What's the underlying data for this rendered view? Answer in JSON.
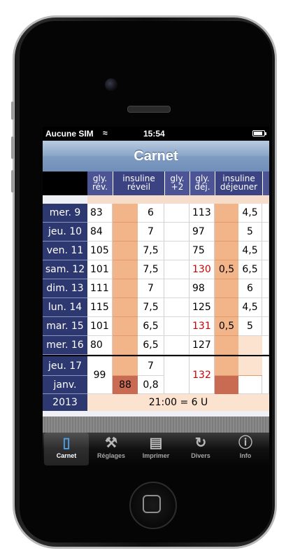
{
  "status": {
    "carrier": "Aucune SIM",
    "time": "15:54"
  },
  "nav": {
    "title": "Carnet"
  },
  "columns": [
    {
      "label": "gly.\nrév."
    },
    {
      "label": "insuline\nréveil"
    },
    {
      "label": "gly.\n+2"
    },
    {
      "label": "gly.\ndéj."
    },
    {
      "label": "insuline\ndéjeuner"
    }
  ],
  "rows": [
    {
      "day": "mer. 9",
      "gly_rev": "83",
      "ins_reveil": "6",
      "gly_plus2": "",
      "gly_dej": "113",
      "ins_dej_a": "",
      "ins_dej_b": "4,5"
    },
    {
      "day": "jeu. 10",
      "gly_rev": "84",
      "ins_reveil": "7",
      "gly_plus2": "",
      "gly_dej": "97",
      "ins_dej_a": "",
      "ins_dej_b": "5"
    },
    {
      "day": "ven. 11",
      "gly_rev": "105",
      "ins_reveil": "7,5",
      "gly_plus2": "",
      "gly_dej": "75",
      "ins_dej_a": "",
      "ins_dej_b": "4,5"
    },
    {
      "day": "sam. 12",
      "gly_rev": "101",
      "ins_reveil": "7,5",
      "gly_plus2": "",
      "gly_dej": "130",
      "ins_dej_a": "0,5",
      "ins_dej_b": "6,5"
    },
    {
      "day": "dim. 13",
      "gly_rev": "111",
      "ins_reveil": "7",
      "gly_plus2": "",
      "gly_dej": "98",
      "ins_dej_a": "",
      "ins_dej_b": "6"
    },
    {
      "day": "lun. 14",
      "gly_rev": "115",
      "ins_reveil": "7,5",
      "gly_plus2": "",
      "gly_dej": "125",
      "ins_dej_a": "",
      "ins_dej_b": "4,5"
    },
    {
      "day": "mar. 15",
      "gly_rev": "101",
      "ins_reveil": "6,5",
      "gly_plus2": "",
      "gly_dej": "131",
      "ins_dej_a": "0,5",
      "ins_dej_b": "5"
    },
    {
      "day": "mer. 16",
      "gly_rev": "80",
      "ins_reveil": "6,5",
      "gly_plus2": "",
      "gly_dej": "127",
      "ins_dej_a": "",
      "ins_dej_b": ""
    }
  ],
  "current": {
    "day": "jeu. 17",
    "month": "janv.",
    "year": "2013",
    "gly_rev": "99",
    "ins_reveil_top": "7",
    "ins_reveil_a": "88",
    "ins_reveil_b": "0,8",
    "gly_dej": "132",
    "note": "21:00 = 6 U"
  },
  "tabs": [
    {
      "label": "Carnet",
      "icon": "notebook-icon"
    },
    {
      "label": "Réglages",
      "icon": "wrench-icon"
    },
    {
      "label": "Imprimer",
      "icon": "document-icon"
    },
    {
      "label": "Divers",
      "icon": "sync-icon"
    },
    {
      "label": "Info",
      "icon": "info-icon"
    }
  ]
}
